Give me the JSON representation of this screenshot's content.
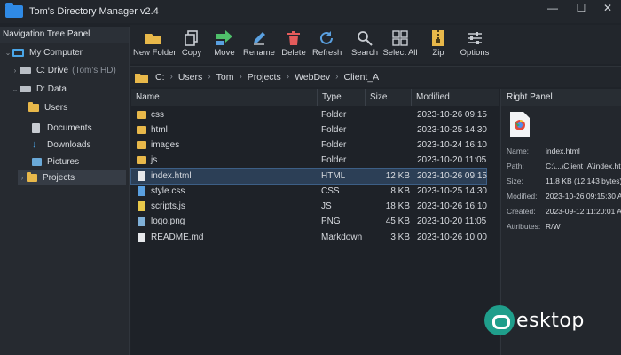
{
  "window": {
    "title": "Tom's Directory Manager v2.4",
    "controls": [
      "—",
      "☐",
      "✕"
    ]
  },
  "nav": {
    "header": "Navigation Tree Panel",
    "items": [
      {
        "label": "My Computer",
        "sub": ""
      },
      {
        "label": "C: Drive",
        "sub": "(Tom's HD)"
      },
      {
        "label": "D: Data",
        "sub": ""
      },
      {
        "label": "Users",
        "sub": ""
      },
      {
        "label": "Documents",
        "sub": ""
      },
      {
        "label": "Downloads",
        "sub": ""
      },
      {
        "label": "Pictures",
        "sub": ""
      },
      {
        "label": "Projects",
        "sub": ""
      }
    ]
  },
  "toolbar": {
    "items": [
      {
        "label": "New Folder",
        "icon": "new-folder-icon"
      },
      {
        "label": "Copy",
        "icon": "copy-icon"
      },
      {
        "label": "Move",
        "icon": "move-icon"
      },
      {
        "label": "Rename",
        "icon": "rename-icon"
      },
      {
        "label": "Delete",
        "icon": "delete-icon"
      },
      {
        "label": "Refresh",
        "icon": "refresh-icon"
      },
      {
        "label": "Search",
        "icon": "search-icon"
      },
      {
        "label": "Select All",
        "icon": "select-all-icon"
      },
      {
        "label": "Zip",
        "icon": "zip-icon"
      },
      {
        "label": "Options",
        "icon": "options-icon"
      }
    ]
  },
  "address": {
    "crumbs": [
      "C:",
      "Users",
      "Tom",
      "Projects",
      "WebDev",
      "Client_A"
    ]
  },
  "files": {
    "columns": [
      "Name",
      "Type",
      "Size",
      "Modified"
    ],
    "rows": [
      {
        "name": "css",
        "type": "Folder",
        "size": "",
        "modified": "2023-10-26 09:15",
        "kind": "folder"
      },
      {
        "name": "html",
        "type": "Folder",
        "size": "",
        "modified": "2023-10-25 14:30",
        "kind": "folder"
      },
      {
        "name": "images",
        "type": "Folder",
        "size": "",
        "modified": "2023-10-24 16:10",
        "kind": "folder"
      },
      {
        "name": "js",
        "type": "Folder",
        "size": "",
        "modified": "2023-10-20 11:05",
        "kind": "folder"
      },
      {
        "name": "index.html",
        "type": "HTML",
        "size": "12 KB",
        "modified": "2023-10-26 09:15",
        "kind": "html"
      },
      {
        "name": "style.css",
        "type": "CSS",
        "size": "8 KB",
        "modified": "2023-10-25 14:30",
        "kind": "css"
      },
      {
        "name": "scripts.js",
        "type": "JS",
        "size": "18 KB",
        "modified": "2023-10-26 16:10",
        "kind": "js"
      },
      {
        "name": "logo.png",
        "type": "PNG",
        "size": "45 KB",
        "modified": "2023-10-20 11:05",
        "kind": "png"
      },
      {
        "name": "README.md",
        "type": "Markdown",
        "size": "3 KB",
        "modified": "2023-10-26 10:00",
        "kind": "md"
      }
    ]
  },
  "right_panel": {
    "header": "Right Panel",
    "props": [
      {
        "key": "Name:",
        "value": "index.html"
      },
      {
        "key": "Path:",
        "value": "C:\\...\\Client_A\\index.html"
      },
      {
        "key": "Size:",
        "value": "11.8 KB (12,143 bytes)"
      },
      {
        "key": "Modified:",
        "value": "2023-10-26 09:15:30 AM"
      },
      {
        "key": "Created:",
        "value": "2023-09-12 11:20:01 AM"
      },
      {
        "key": "Attributes:",
        "value": "R/W"
      }
    ]
  },
  "watermark": {
    "text": "esktop"
  },
  "colors": {
    "accent": "#2f8ae6",
    "folder": "#e8b84a",
    "selection": "#2c3f56",
    "background": "#1f2329"
  }
}
